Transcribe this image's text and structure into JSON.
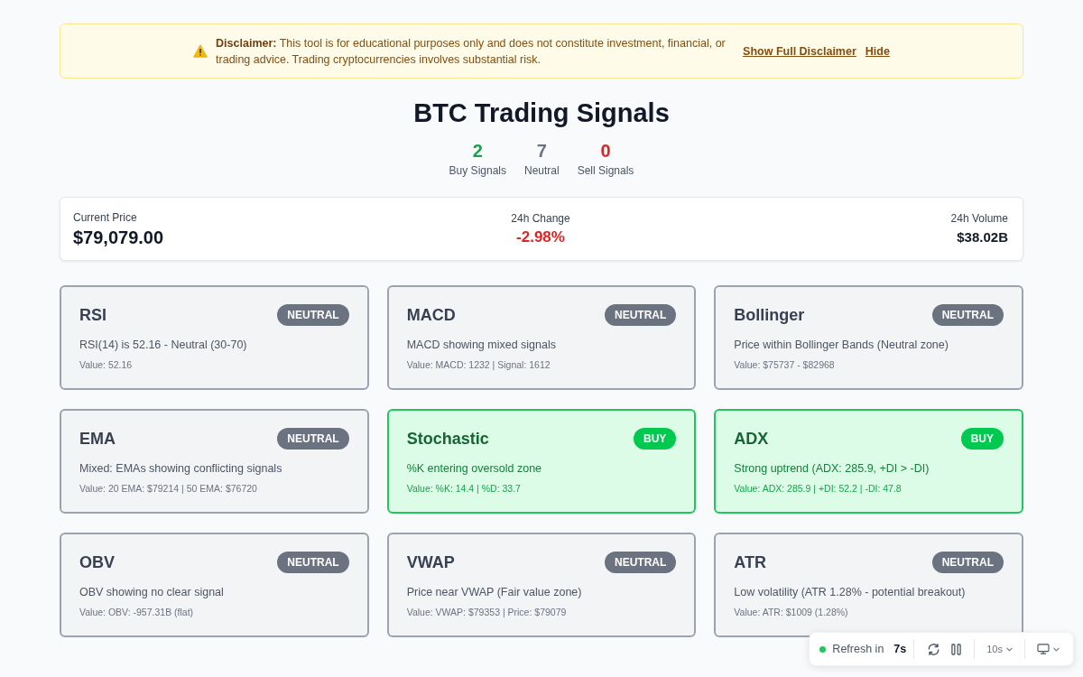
{
  "disclaimer": {
    "text": "**Disclaimer:** This tool is for educational purposes only and does not constitute investment, financial, or trading advice. Trading cryptocurrencies involves substantial risk.",
    "links": [
      "Show Full Disclaimer",
      "Hide"
    ]
  },
  "title": "BTC Trading Signals",
  "summary": [
    {
      "kind": "buy",
      "count": "2",
      "label": "Buy Signals"
    },
    {
      "kind": "neutral",
      "count": "7",
      "label": "Neutral"
    },
    {
      "kind": "sell",
      "count": "0",
      "label": "Sell Signals"
    }
  ],
  "market": [
    {
      "kind": "price",
      "label": "Current Price",
      "value": "$79,079.00"
    },
    {
      "kind": "change",
      "label": "24h Change",
      "value": "-2.98%",
      "negative": true
    },
    {
      "kind": "volume",
      "label": "24h Volume",
      "value": "$38.02B"
    }
  ],
  "indicators": [
    {
      "name": "RSI",
      "kind": "neutral",
      "signal": "NEUTRAL",
      "description": "RSI(14) is 52.16 - Neutral (30-70)",
      "value": "Value: 52.16"
    },
    {
      "name": "MACD",
      "kind": "neutral",
      "signal": "NEUTRAL",
      "description": "MACD showing mixed signals",
      "value": "Value: MACD: 1232 | Signal: 1612"
    },
    {
      "name": "Bollinger",
      "kind": "neutral",
      "signal": "NEUTRAL",
      "description": "Price within Bollinger Bands (Neutral zone)",
      "value": "Value: $75737 - $82968"
    },
    {
      "name": "EMA",
      "kind": "neutral",
      "signal": "NEUTRAL",
      "description": "Mixed: EMAs showing conflicting signals",
      "value": "Value: 20 EMA: $79214 | 50 EMA: $76720"
    },
    {
      "name": "Stochastic",
      "kind": "buy",
      "signal": "BUY",
      "description": "%K entering oversold zone",
      "value": "Value: %K: 14.4 | %D: 33.7"
    },
    {
      "name": "ADX",
      "kind": "buy",
      "signal": "BUY",
      "description": "Strong uptrend (ADX: 285.9, +DI > -DI)",
      "value": "Value: ADX: 285.9 | +DI: 52.2 | -DI: 47.8"
    },
    {
      "name": "OBV",
      "kind": "neutral",
      "signal": "NEUTRAL",
      "description": "OBV showing no clear signal",
      "value": "Value: OBV: -957.31B (flat)"
    },
    {
      "name": "VWAP",
      "kind": "neutral",
      "signal": "NEUTRAL",
      "description": "Price near VWAP (Fair value zone)",
      "value": "Value: VWAP: $79353 | Price: $79079"
    },
    {
      "name": "ATR",
      "kind": "neutral",
      "signal": "NEUTRAL",
      "description": "Low volatility (ATR 1.28% - potential breakout)",
      "value": "Value: ATR: $1009 (1.28%)"
    }
  ],
  "refresh_bar": {
    "active": true,
    "label": "Refresh in",
    "countdown": "7s",
    "interval": "10s"
  }
}
